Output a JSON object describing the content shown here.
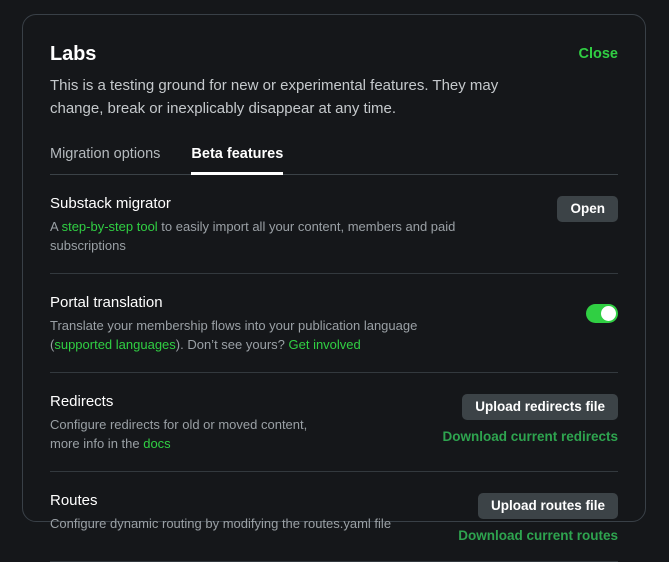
{
  "modal": {
    "title": "Labs",
    "close_label": "Close",
    "subtitle": "This is a testing ground for new or experimental features. They may change, break or inexplicably disappear at any time.",
    "tabs": [
      {
        "label": "Migration options",
        "active": false
      },
      {
        "label": "Beta features",
        "active": true
      }
    ]
  },
  "features": [
    {
      "title": "Substack migrator",
      "desc_pre": "A ",
      "desc_link": "step-by-step tool",
      "desc_post": " to easily import all your content, members and paid subscriptions",
      "button_label": "Open"
    },
    {
      "title": "Portal translation",
      "desc_pre": "Translate your membership flows into your publication language (",
      "desc_link": "supported languages",
      "desc_mid": "). Don’t see yours? ",
      "desc_link2": "Get involved",
      "toggle_state": "on"
    },
    {
      "title": "Redirects",
      "desc_pre": "Configure redirects for old or moved content, more info in the ",
      "desc_link": "docs",
      "button_label": "Upload redirects file",
      "download_label": "Download current redirects"
    },
    {
      "title": "Routes",
      "desc_pre": "Configure dynamic routing by modifying the routes.yaml file",
      "button_label": "Upload routes file",
      "download_label": "Download current routes"
    }
  ],
  "colors": {
    "accent_green": "#30cf43",
    "download_green": "#2ea44f",
    "background": "#15171a",
    "button_bg": "#3c4347",
    "border": "#33393e"
  }
}
